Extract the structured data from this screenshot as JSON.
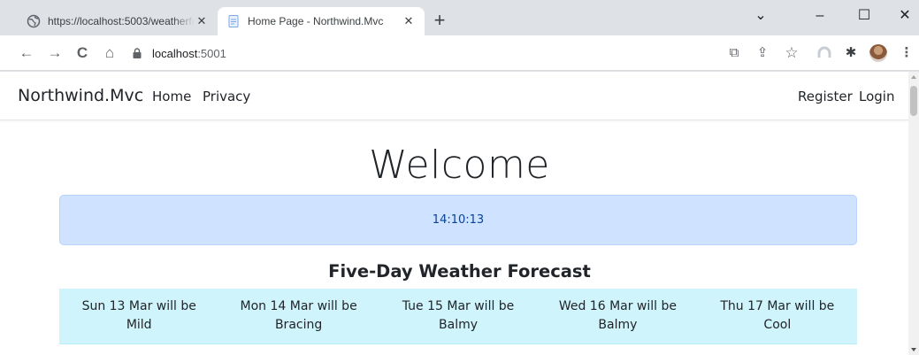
{
  "browser": {
    "tabs": [
      {
        "title": "https://localhost:5003/weatherforecast",
        "active": false,
        "icon": "globe-icon"
      },
      {
        "title": "Home Page - Northwind.Mvc",
        "active": true,
        "icon": "page-icon"
      }
    ],
    "new_tab_glyph": "+",
    "window_controls": {
      "minimize": "–",
      "maximize": "☐",
      "close": "✕",
      "tab_search": "⌄"
    },
    "address": {
      "host": "localhost",
      "port": ":5001"
    },
    "nav_glyphs": {
      "back": "←",
      "forward": "→",
      "reload": "C",
      "home": "⌂"
    },
    "toolbar_glyphs": {
      "open_in_app": "⧉",
      "share": "⇪",
      "bookmark": "☆",
      "extensions": "✱",
      "menu": "⋮"
    }
  },
  "site": {
    "brand": "Northwind.Mvc",
    "nav": {
      "home": "Home",
      "privacy": "Privacy",
      "register": "Register",
      "login": "Login"
    }
  },
  "main": {
    "heading": "Welcome",
    "time": "14:10:13",
    "forecast_title": "Five-Day Weather Forecast",
    "forecast": [
      {
        "day": "Sun 13 Mar will be",
        "summary": "Mild"
      },
      {
        "day": "Mon 14 Mar will be",
        "summary": "Bracing"
      },
      {
        "day": "Tue 15 Mar will be",
        "summary": "Balmy"
      },
      {
        "day": "Wed 16 Mar will be",
        "summary": "Balmy"
      },
      {
        "day": "Thu 17 Mar will be",
        "summary": "Cool"
      }
    ]
  },
  "colors": {
    "alert_bg": "#cfe2ff",
    "alert_text": "#084298",
    "forecast_bg": "#cff4fc",
    "chrome_bg": "#dee1e6"
  }
}
